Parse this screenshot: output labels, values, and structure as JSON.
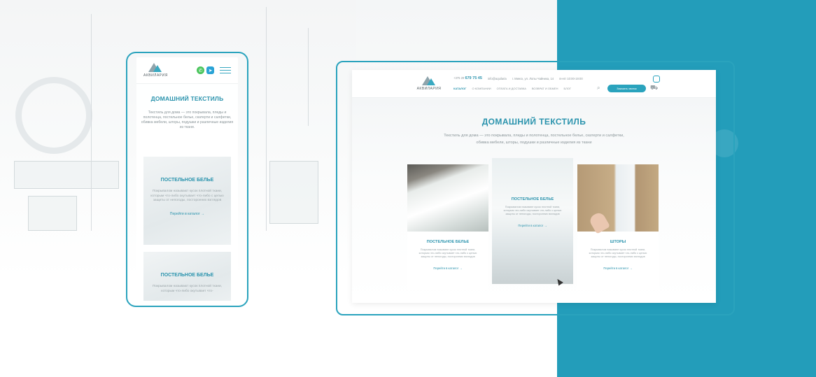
{
  "brand": {
    "name": "АКВИЛАРИЯ"
  },
  "mobile": {
    "title": "ДОМАШНИЙ ТЕКСТИЛЬ",
    "description": "Текстиль для дома — это покрывала, пледы и полотенца, постельное белье, скатерти и салфетки, обивка мебели, шторы, подушки и различные изделия из ткани.",
    "cards": [
      {
        "title": "ПОСТЕЛЬНОЕ БЕЛЬЕ",
        "text": "Покрывалом называют кусок плотной ткани, которым что-либо окутывает что-либо с целью защиты от непогоды, посторонних взглядов",
        "link": "Перейти в каталог →"
      },
      {
        "title": "ПОСТЕЛЬНОЕ БЕЛЬЕ",
        "text": "Покрывалом называют кусок плотной ткани, которым что-либо окутывает что-"
      }
    ],
    "icons": [
      "whatsapp-icon",
      "telegram-icon",
      "menu-icon"
    ]
  },
  "desktop": {
    "header": {
      "phone_prefix": "+375 29",
      "phone": "679 75 45",
      "email": "info@aquilaria",
      "address": "г. Минск, ул. Лопы Чайника, 14",
      "hours": "пн-вт 10:00-19:00",
      "cta": "Заказать звонок",
      "nav": [
        "КАТАЛОГ",
        "О КОМПАНИИ",
        "ОПЛАТА И ДОСТАВКА",
        "ВОЗВРАТ И ОБМЕН",
        "БЛОГ"
      ]
    },
    "title": "ДОМАШНИЙ ТЕКСТИЛЬ",
    "description": "Текстиль для дома — это покрывала, пледы и полотенца, постельное белье, скатерти и салфетки, обивка мебели, шторы, подушки и различные изделия из ткани",
    "cards": [
      {
        "title": "ПОСТЕЛЬНОЕ БЕЛЬЕ",
        "text": "Покрывалом называют кусок плотной ткани, которым что-либо окутывает что-либо с целью защиты от непогоды, посторонних взглядов",
        "link": "Перейти в каталог →"
      },
      {
        "title": "ПОСТЕЛЬНОЕ БЕЛЬЕ",
        "text": "Покрывалом называют кусок плотной ткани, которым что-либо окутывает что-либо с целью защиты от непогоды, посторонних взглядов",
        "link": "Перейти в каталог →"
      },
      {
        "title": "ШТОРЫ",
        "text": "Покрывалом называют кусок плотной ткани, которым что-либо окутывает что-либо с целью защиты от непогоды, посторонних взглядов",
        "link": "Перейти в каталог →"
      }
    ]
  },
  "colors": {
    "accent": "#239dba",
    "panel": "#239dba"
  }
}
